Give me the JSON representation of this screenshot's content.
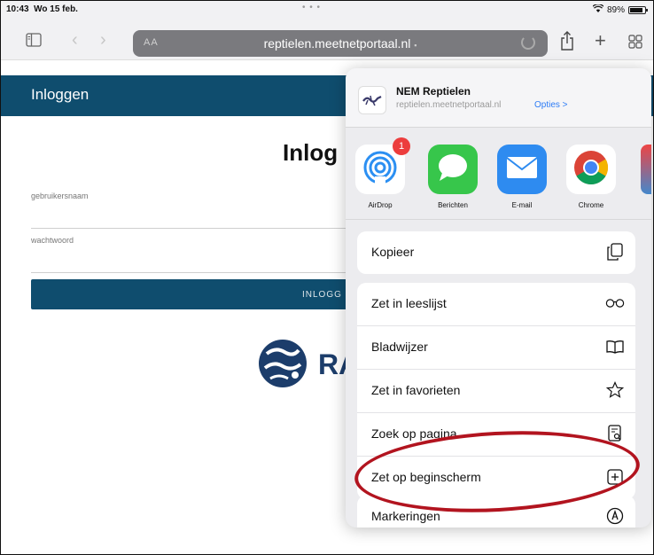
{
  "status": {
    "time": "10:43",
    "date": "Wo 15 feb.",
    "battery": "89%",
    "battery_level": 0.89
  },
  "toolbar": {
    "text_size_label": "AA",
    "url": "reptielen.meetnetportaal.nl"
  },
  "page": {
    "header_title": "Inloggen",
    "main_title": "Inlog",
    "username_label": "gebruikersnaam",
    "password_label": "wachtwoord",
    "login_button": "INLOGG",
    "logo_text": "RA"
  },
  "share": {
    "site_title": "NEM Reptielen",
    "site_url": "reptielen.meetnetportaal.nl",
    "options_label": "Opties >",
    "apps": [
      {
        "label": "AirDrop",
        "badge": "1",
        "icon": "airdrop-icon"
      },
      {
        "label": "Berichten",
        "icon": "messages-icon"
      },
      {
        "label": "E-mail",
        "icon": "mail-icon"
      },
      {
        "label": "Chrome",
        "icon": "chrome-icon"
      }
    ],
    "actions": {
      "copy": "Kopieer",
      "reading_list": "Zet in leeslijst",
      "bookmark": "Bladwijzer",
      "favorites": "Zet in favorieten",
      "find": "Zoek op pagina",
      "home_screen": "Zet op beginscherm",
      "markup": "Markeringen"
    }
  },
  "colors": {
    "header_blue": "#0f4d6e",
    "highlight_red": "#b2141f",
    "link_blue": "#2d7cf6"
  }
}
